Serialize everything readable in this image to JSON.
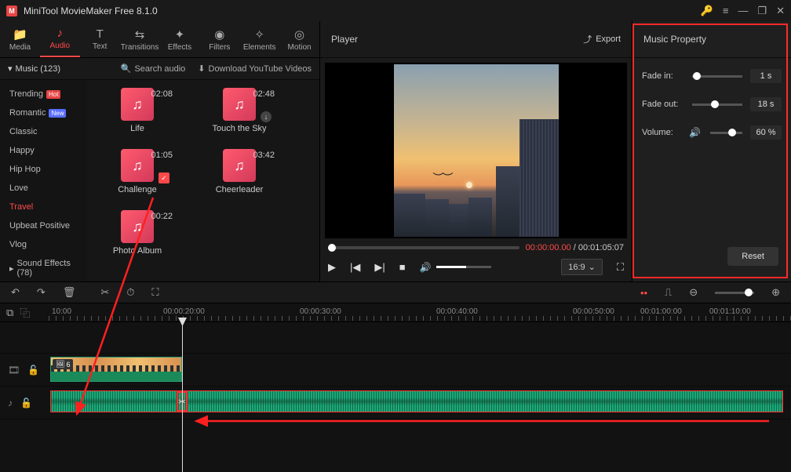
{
  "titlebar": {
    "app_title": "MiniTool MovieMaker Free 8.1.0"
  },
  "tabs": {
    "media": "Media",
    "audio": "Audio",
    "text": "Text",
    "transitions": "Transitions",
    "effects": "Effects",
    "filters": "Filters",
    "elements": "Elements",
    "motion": "Motion"
  },
  "sub": {
    "category": "Music (123)",
    "search": "Search audio",
    "download": "Download YouTube Videos"
  },
  "sidebar": {
    "items": [
      {
        "label": "Trending",
        "badge": "Hot",
        "badgeCls": "hot"
      },
      {
        "label": "Romantic",
        "badge": "New",
        "badgeCls": "new"
      },
      {
        "label": "Classic"
      },
      {
        "label": "Happy"
      },
      {
        "label": "Hip Hop"
      },
      {
        "label": "Love"
      },
      {
        "label": "Travel",
        "active": true
      },
      {
        "label": "Upbeat Positive"
      },
      {
        "label": "Vlog"
      }
    ],
    "sound": "Sound Effects (78)"
  },
  "tracks": [
    {
      "title": "Life",
      "dur": "02:08"
    },
    {
      "title": "Touch the Sky",
      "dur": "02:48",
      "dl": true
    },
    {
      "title": "Challenge",
      "dur": "01:05",
      "checked": true
    },
    {
      "title": "Cheerleader",
      "dur": "03:42"
    },
    {
      "title": "Photo Album",
      "dur": "00:22"
    }
  ],
  "player": {
    "title": "Player",
    "export": "Export",
    "cur": "00:00:00.00",
    "total": "00:01:05:07",
    "aspect": "16:9"
  },
  "props": {
    "title": "Music Property",
    "fadein_lbl": "Fade in:",
    "fadein_val": "1 s",
    "fadeout_lbl": "Fade out:",
    "fadeout_val": "18 s",
    "vol_lbl": "Volume:",
    "vol_val": "60 %",
    "reset": "Reset"
  },
  "ruler": {
    "t0": "10:00",
    "t1": "00:00:20:00",
    "t2": "00:00:30:00",
    "t3": "00:00:40:00",
    "t4": "00:00:50:00",
    "t5": "00:01:00:00",
    "t6": "00:01:10:00"
  },
  "clip": {
    "badge": "6"
  }
}
